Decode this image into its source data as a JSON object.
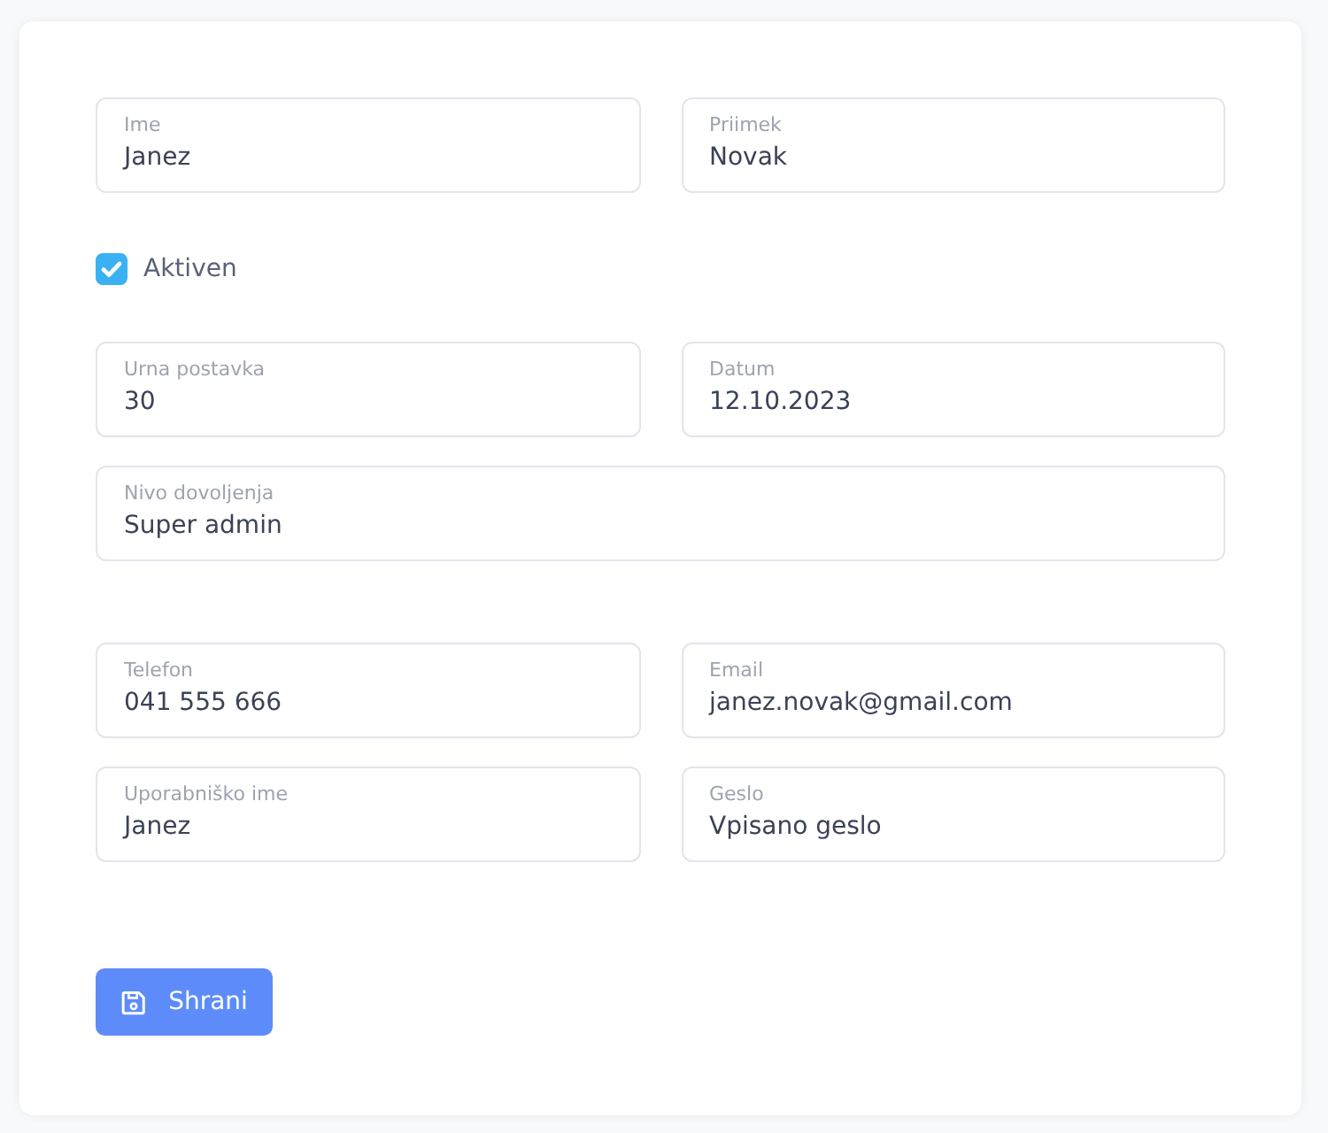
{
  "sections": [
    {
      "kind": "fields",
      "rows": [
        [
          {
            "label": "Ime",
            "value": "Janez"
          },
          {
            "label": "Priimek",
            "value": "Novak"
          }
        ]
      ]
    },
    {
      "kind": "checkbox",
      "label": "Aktiven",
      "checked": true
    },
    {
      "kind": "fields",
      "rows": [
        [
          {
            "label": "Urna postavka",
            "value": "30"
          },
          {
            "label": "Datum",
            "value": "12.10.2023"
          }
        ],
        [
          {
            "label": "Nivo dovoljenja",
            "value": "Super admin"
          }
        ]
      ]
    },
    {
      "kind": "fields",
      "rows": [
        [
          {
            "label": "Telefon",
            "value": "041 555 666"
          },
          {
            "label": "Email",
            "value": "janez.novak@gmail.com"
          }
        ],
        [
          {
            "label": "Uporabniško ime",
            "value": "Janez"
          },
          {
            "label": "Geslo",
            "value": "Vpisano geslo"
          }
        ]
      ]
    },
    {
      "kind": "button",
      "label": "Shrani"
    }
  ]
}
